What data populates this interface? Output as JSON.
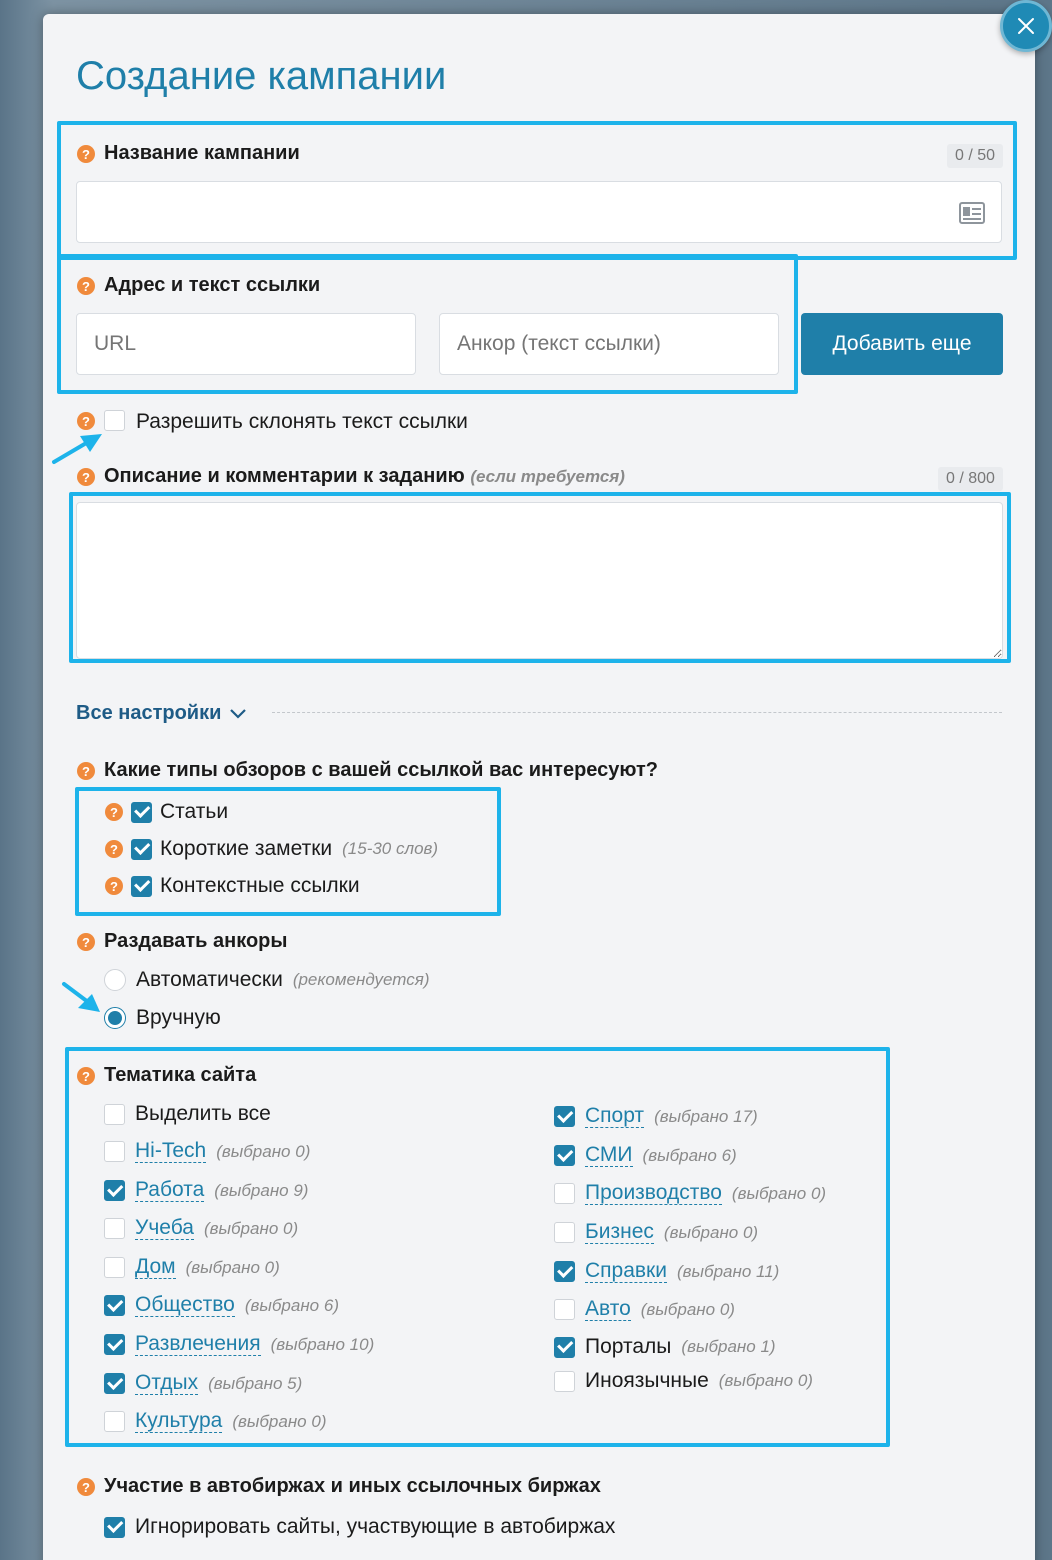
{
  "modal": {
    "title": "Создание кампании"
  },
  "campaign_name": {
    "label": "Название кампании",
    "counter": "0 / 50",
    "value": ""
  },
  "link": {
    "label": "Адрес и текст ссылки",
    "url_placeholder": "URL",
    "anchor_placeholder": "Анкор (текст ссылки)",
    "add_button": "Добавить еще"
  },
  "decline": {
    "label": "Разрешить склонять текст ссылки",
    "checked": false
  },
  "description": {
    "label": "Описание и комментарии к заданию",
    "hint": "(если требуется)",
    "counter": "0 / 800"
  },
  "settings": {
    "label": "Все настройки"
  },
  "review_types": {
    "label": "Какие типы обзоров с вашей ссылкой вас интересуют?",
    "items": [
      {
        "label": "Статьи",
        "note": "",
        "checked": true
      },
      {
        "label": "Короткие заметки",
        "note": "(15-30 слов)",
        "checked": true
      },
      {
        "label": "Контекстные ссылки",
        "note": "",
        "checked": true
      }
    ]
  },
  "anchors": {
    "label": "Раздавать анкоры",
    "options": [
      {
        "label": "Автоматически",
        "note": "(рекомендуется)",
        "selected": false
      },
      {
        "label": "Вручную",
        "note": "",
        "selected": true
      }
    ]
  },
  "topics": {
    "label": "Тематика сайта",
    "select_all": "Выделить все",
    "left": [
      {
        "label": "Hi-Tech",
        "note": "(выбрано 0)",
        "checked": false
      },
      {
        "label": "Работа",
        "note": "(выбрано 9)",
        "checked": true
      },
      {
        "label": "Учеба",
        "note": "(выбрано 0)",
        "checked": false
      },
      {
        "label": "Дом",
        "note": "(выбрано 0)",
        "checked": false
      },
      {
        "label": "Общество",
        "note": "(выбрано 6)",
        "checked": true
      },
      {
        "label": "Развлечения",
        "note": "(выбрано 10)",
        "checked": true
      },
      {
        "label": "Отдых",
        "note": "(выбрано 5)",
        "checked": true
      },
      {
        "label": "Культура",
        "note": "(выбрано 0)",
        "checked": false
      }
    ],
    "right": [
      {
        "label": "Спорт",
        "note": "(выбрано 17)",
        "checked": true
      },
      {
        "label": "СМИ",
        "note": "(выбрано 6)",
        "checked": true
      },
      {
        "label": "Производство",
        "note": "(выбрано 0)",
        "checked": false
      },
      {
        "label": "Бизнес",
        "note": "(выбрано 0)",
        "checked": false
      },
      {
        "label": "Справки",
        "note": "(выбрано 11)",
        "checked": true
      },
      {
        "label": "Авто",
        "note": "(выбрано 0)",
        "checked": false
      },
      {
        "label": "Порталы",
        "note": "(выбрано 1)",
        "checked": true
      },
      {
        "label": "Иноязычные",
        "note": "(выбрано 0)",
        "checked": false
      }
    ]
  },
  "exchanges": {
    "label": "Участие в автобиржах и иных ссылочных биржах",
    "ignore_label": "Игнорировать сайты, участвующие в автобиржах",
    "checked": true
  },
  "colors": {
    "accent": "#1f7fa9",
    "highlight": "#1db3ea",
    "help": "#f08a3c"
  }
}
